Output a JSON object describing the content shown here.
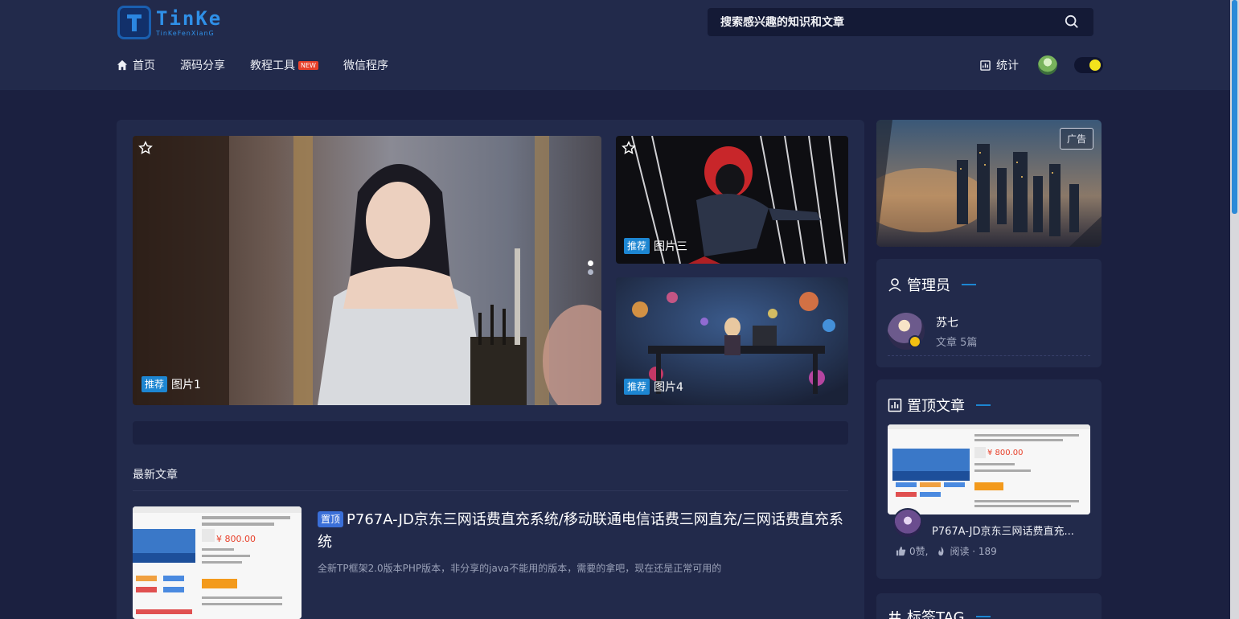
{
  "header": {
    "logo_main": "TinKe",
    "logo_sub": "TinKeFenXianG",
    "search_placeholder": "搜索感兴趣的知识和文章",
    "nav": [
      {
        "label": "首页",
        "icon": "home-icon"
      },
      {
        "label": "源码分享"
      },
      {
        "label": "教程工具",
        "badge": "NEW"
      },
      {
        "label": "微信程序"
      }
    ],
    "stats_label": "统计"
  },
  "carousel": {
    "main": {
      "tag": "推荐",
      "title": "图片1"
    },
    "side_top": {
      "tag": "推荐",
      "title": "图片三"
    },
    "side_bottom": {
      "tag": "推荐",
      "title": "图片4"
    }
  },
  "latest": {
    "section_title": "最新文章",
    "posts": [
      {
        "top_tag": "置顶",
        "title": "P767A-JD京东三网话费直充系统/移动联通电信话费三网直充/三网话费直充系统",
        "excerpt": "全新TP框架2.0版本PHP版本，非分享的java不能用的版本，需要的拿吧，现在还是正常可用的",
        "thumb_price": "¥ 800.00"
      }
    ]
  },
  "sidebar": {
    "ad_label": "广告",
    "admin": {
      "heading": "管理员",
      "name": "苏七",
      "posts": "文章 5篇"
    },
    "pinned": {
      "heading": "置顶文章",
      "title": "P767A-JD京东三网话费直充...",
      "likes": "0赞,",
      "reads": "阅读 · 189",
      "thumb_price": "¥ 800.00"
    },
    "tags_heading": "标签TAG"
  },
  "colors": {
    "accent": "#1d86d2",
    "bg": "#1b2040",
    "card": "#222a4b",
    "toggle_knob": "#f3e21c"
  }
}
